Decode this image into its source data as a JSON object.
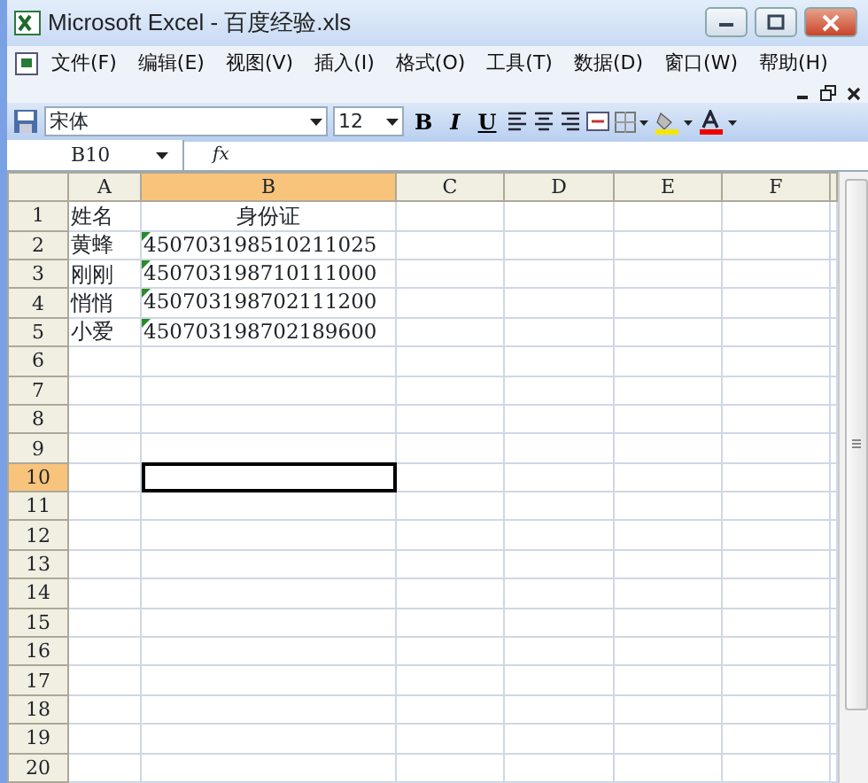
{
  "window": {
    "title": "Microsoft Excel - 百度经验.xls"
  },
  "menu": [
    "文件(F)",
    "编辑(E)",
    "视图(V)",
    "插入(I)",
    "格式(O)",
    "工具(T)",
    "数据(D)",
    "窗口(W)",
    "帮助(H)"
  ],
  "toolbar": {
    "font": "宋体",
    "size": "12",
    "styles": [
      "B",
      "I",
      "U"
    ]
  },
  "formula_bar": {
    "name_box": "B10",
    "fx": "fx"
  },
  "sheet": {
    "columns": [
      {
        "label": "A",
        "selected": false
      },
      {
        "label": "B",
        "selected": true
      },
      {
        "label": "C",
        "selected": false
      },
      {
        "label": "D",
        "selected": false
      },
      {
        "label": "E",
        "selected": false
      },
      {
        "label": "F",
        "selected": false
      }
    ],
    "rows": [
      {
        "label": "1",
        "selected": false,
        "cells": [
          {
            "text": "姓名"
          },
          {
            "text": "身份证",
            "centered": true
          }
        ]
      },
      {
        "label": "2",
        "selected": false,
        "cells": [
          {
            "text": "黄蜂"
          },
          {
            "text": "450703198510211025",
            "error_flag": true
          }
        ]
      },
      {
        "label": "3",
        "selected": false,
        "cells": [
          {
            "text": "刚刚"
          },
          {
            "text": "450703198710111000",
            "error_flag": true
          }
        ]
      },
      {
        "label": "4",
        "selected": false,
        "cells": [
          {
            "text": "悄悄"
          },
          {
            "text": "450703198702111200",
            "error_flag": true
          }
        ]
      },
      {
        "label": "5",
        "selected": false,
        "cells": [
          {
            "text": "小爱"
          },
          {
            "text": "450703198702189600",
            "error_flag": true
          }
        ]
      },
      {
        "label": "6",
        "selected": false,
        "cells": []
      },
      {
        "label": "7",
        "selected": false,
        "cells": []
      },
      {
        "label": "8",
        "selected": false,
        "cells": []
      },
      {
        "label": "9",
        "selected": false,
        "cells": []
      },
      {
        "label": "10",
        "selected": true,
        "cells": [
          {
            "text": ""
          },
          {
            "text": "",
            "active": true
          }
        ]
      },
      {
        "label": "11",
        "selected": false,
        "cells": []
      },
      {
        "label": "12",
        "selected": false,
        "cells": []
      },
      {
        "label": "13",
        "selected": false,
        "cells": []
      },
      {
        "label": "14",
        "selected": false,
        "cells": []
      },
      {
        "label": "15",
        "selected": false,
        "cells": []
      },
      {
        "label": "16",
        "selected": false,
        "cells": []
      },
      {
        "label": "17",
        "selected": false,
        "cells": []
      },
      {
        "label": "18",
        "selected": false,
        "cells": []
      },
      {
        "label": "19",
        "selected": false,
        "cells": []
      },
      {
        "label": "20",
        "selected": false,
        "cells": []
      }
    ]
  }
}
